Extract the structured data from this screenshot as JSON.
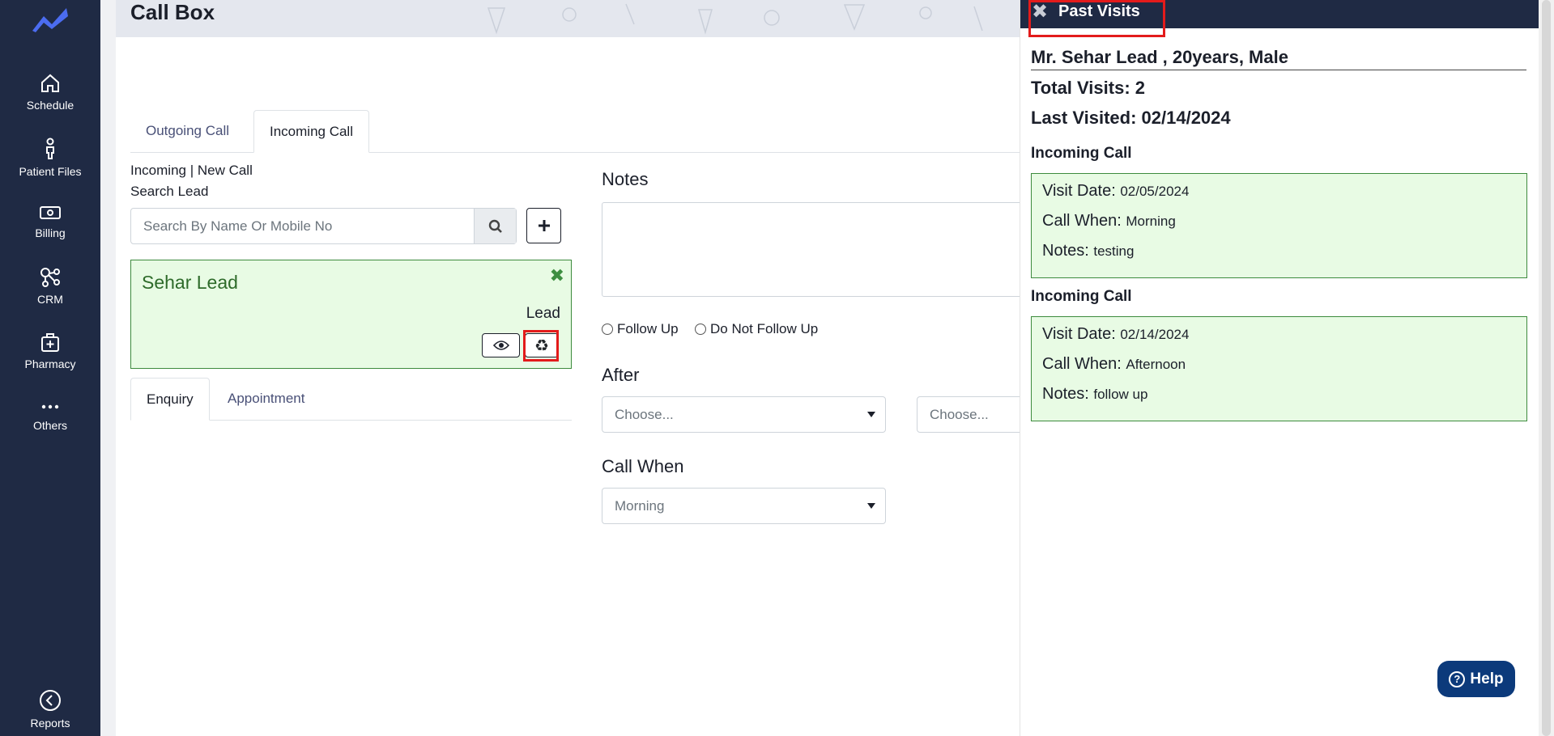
{
  "sidebar": {
    "items": [
      {
        "label": "Schedule",
        "icon": "home-icon"
      },
      {
        "label": "Patient Files",
        "icon": "person-icon"
      },
      {
        "label": "Billing",
        "icon": "money-icon"
      },
      {
        "label": "CRM",
        "icon": "crm-icon"
      },
      {
        "label": "Pharmacy",
        "icon": "pharmacy-icon"
      },
      {
        "label": "Others",
        "icon": "more-icon"
      },
      {
        "label": "Reports",
        "icon": "reports-icon"
      }
    ]
  },
  "header": {
    "title": "Call Box"
  },
  "tabs": [
    {
      "label": "Outgoing Call"
    },
    {
      "label": "Incoming Call",
      "active": true
    }
  ],
  "form": {
    "status_text": "Incoming | New Call",
    "search_label": "Search Lead",
    "search_placeholder": "Search By Name Or Mobile No"
  },
  "lead": {
    "name": "Sehar Lead",
    "type": "Lead",
    "close_symbol": "✖",
    "recycle_symbol": "♻"
  },
  "subtabs": [
    {
      "label": "Enquiry",
      "active": true
    },
    {
      "label": "Appointment"
    }
  ],
  "notes": {
    "label": "Notes",
    "follow_up": "Follow Up",
    "do_not_follow_up": "Do Not Follow Up",
    "after_label": "After",
    "after_select_1": "Choose...",
    "after_select_2": "Choose...",
    "call_when_label": "Call When",
    "call_when_value": "Morning"
  },
  "panel": {
    "title": "Past Visits",
    "close_symbol": "✖",
    "patient": "Mr. Sehar Lead , 20years, Male",
    "total_visits": "Total Visits: 2",
    "last_visited": "Last Visited: 02/14/2024",
    "visits": [
      {
        "type": "Incoming Call",
        "date_label": "Visit Date:",
        "date": "02/05/2024",
        "when_label": "Call When:",
        "when": "Morning",
        "notes_label": "Notes:",
        "notes": "testing"
      },
      {
        "type": "Incoming Call",
        "date_label": "Visit Date:",
        "date": "02/14/2024",
        "when_label": "Call When:",
        "when": "Afternoon",
        "notes_label": "Notes:",
        "notes": "follow up"
      }
    ]
  },
  "help": {
    "label": "Help",
    "q": "?"
  },
  "colors": {
    "sidebar": "#1f2a44",
    "accent": "#2f5bd3",
    "card_bg": "#e8fbe4",
    "card_border": "#3d8b3d",
    "highlight": "#e31b1b"
  }
}
